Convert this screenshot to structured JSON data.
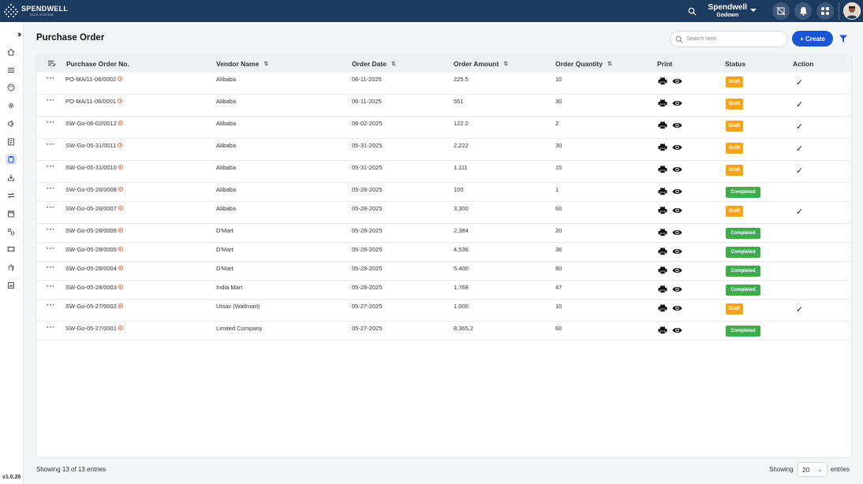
{
  "brand": {
    "name": "SPENDWELL",
    "sub": "TECH SYSTEM"
  },
  "header": {
    "org_name": "Spendwell",
    "org_sub": "Godown"
  },
  "sidebar": {
    "version": "v1.0.26"
  },
  "page": {
    "title": "Purchase Order",
    "search_placeholder": "Search here",
    "create_label": "+ Create"
  },
  "table": {
    "columns": {
      "po_no": "Purchase Order No.",
      "vendor": "Vendor Name",
      "date": "Order Date",
      "amount": "Order Amount",
      "qty": "Order Quantity",
      "print": "Print",
      "status": "Status",
      "action": "Action"
    },
    "rows": [
      {
        "po": "PO-MA/11-06/0002",
        "vendor": "Alibaba",
        "date": "06-11-2025",
        "amount": "225.5",
        "qty": "10",
        "status": "Draft",
        "check": "✓"
      },
      {
        "po": "PO-MA/11-06/0001",
        "vendor": "Alibaba",
        "date": "06-11-2025",
        "amount": "551",
        "qty": "30",
        "status": "Draft",
        "check": "✓"
      },
      {
        "po": "SW-Go-06-02/0012",
        "vendor": "Alibaba",
        "date": "06-02-2025",
        "amount": "122.2",
        "qty": "2",
        "status": "Draft",
        "check": "✓"
      },
      {
        "po": "SW-Go-05-31/0011",
        "vendor": "Alibaba",
        "date": "05-31-2025",
        "amount": "2,222",
        "qty": "30",
        "status": "Draft",
        "check": "✓"
      },
      {
        "po": "SW-Go-05-31/0010",
        "vendor": "Alibaba",
        "date": "05-31-2025",
        "amount": "1,111",
        "qty": "15",
        "status": "Draft",
        "check": "✓"
      },
      {
        "po": "SW-Go-05-28/0008",
        "vendor": "Alibaba",
        "date": "05-28-2025",
        "amount": "100",
        "qty": "1",
        "status": "Completed",
        "check": ""
      },
      {
        "po": "SW-Go-05-28/0007",
        "vendor": "Alibaba",
        "date": "05-28-2025",
        "amount": "3,300",
        "qty": "60",
        "status": "Draft",
        "check": "✓"
      },
      {
        "po": "SW-Go-05-28/0006",
        "vendor": "D'Mart",
        "date": "05-28-2025",
        "amount": "2,384",
        "qty": "20",
        "status": "Completed",
        "check": ""
      },
      {
        "po": "SW-Go-05-28/0005",
        "vendor": "D'Mart",
        "date": "05-28-2025",
        "amount": "4,536",
        "qty": "36",
        "status": "Completed",
        "check": ""
      },
      {
        "po": "SW-Go-05-28/0004",
        "vendor": "D'Mart",
        "date": "05-28-2025",
        "amount": "5,400",
        "qty": "80",
        "status": "Completed",
        "check": ""
      },
      {
        "po": "SW-Go-05-28/0003",
        "vendor": "India Mart",
        "date": "05-28-2025",
        "amount": "1,768",
        "qty": "47",
        "status": "Completed",
        "check": ""
      },
      {
        "po": "SW-Go-05-27/0002",
        "vendor": "Utsav  (Wallmart)",
        "date": "05-27-2025",
        "amount": "1,000",
        "qty": "10",
        "status": "Draft",
        "check": "✓"
      },
      {
        "po": "SW-Go-05-27/0001",
        "vendor": "Limited Company",
        "date": "05-27-2025",
        "amount": "8,365.2",
        "qty": "60",
        "status": "Completed",
        "check": ""
      }
    ]
  },
  "footer": {
    "info": "Showing 13 of 13 entries",
    "showing_label": "Showing",
    "page_size": "20",
    "entries_label": "entries"
  },
  "colors": {
    "topbar": "#1d3a5f",
    "primary": "#1856d6",
    "draft": "#f6a21a",
    "completed": "#3fac4b"
  }
}
